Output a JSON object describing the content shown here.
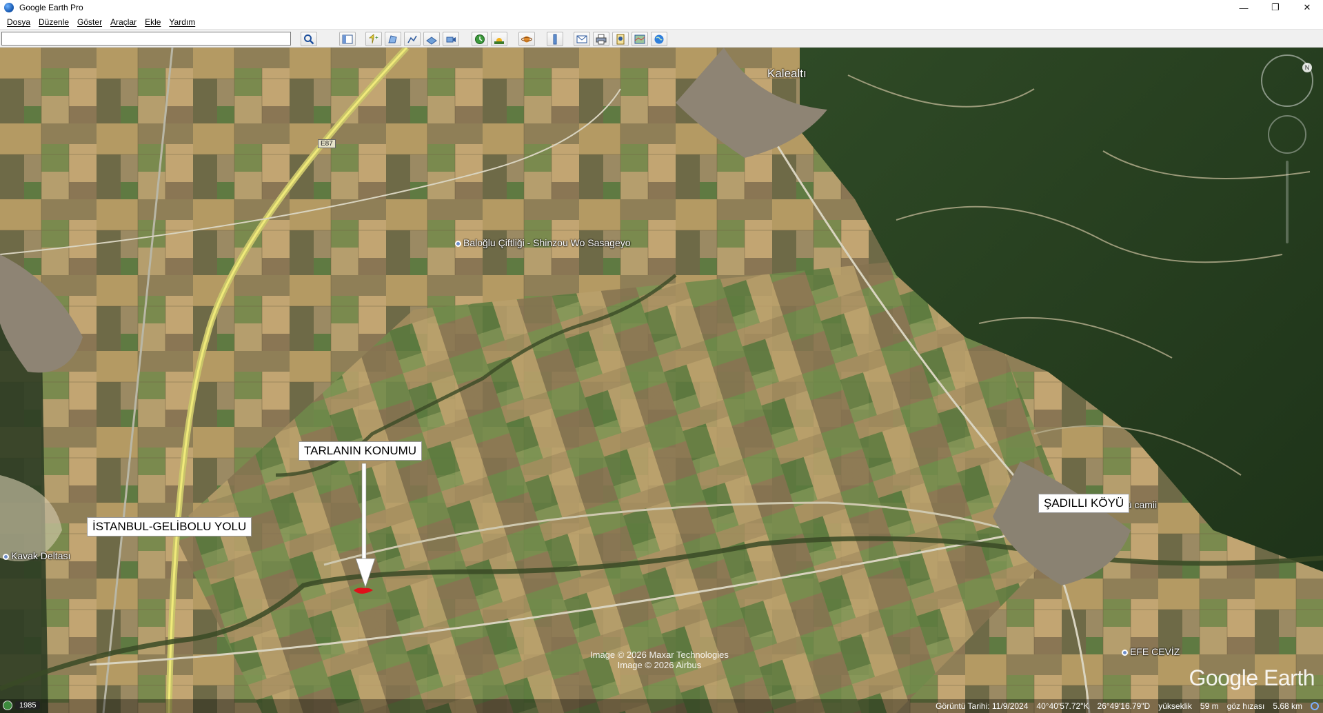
{
  "window": {
    "title": "Google Earth Pro",
    "minimize": "—",
    "maximize": "❐",
    "close": "✕"
  },
  "menu": [
    "Dosya",
    "Düzenle",
    "Göster",
    "Araçlar",
    "Ekle",
    "Yardım"
  ],
  "search": {
    "value": "",
    "placeholder": ""
  },
  "toolbar_icons": [
    "search-icon",
    "sidebar-toggle-icon",
    "add-placemark-icon",
    "add-polygon-icon",
    "add-path-icon",
    "add-image-overlay-icon",
    "record-tour-icon",
    "historical-imagery-icon",
    "sunlight-icon",
    "planets-icon",
    "ruler-icon",
    "email-icon",
    "print-icon",
    "save-image-icon",
    "view-in-maps-icon",
    "earth-gallery-icon"
  ],
  "map": {
    "annotations": {
      "field_location": "TARLANIN KONUMU",
      "road": "İSTANBUL-GELİBOLU YOLU",
      "village": "ŞADILLI KÖYÜ"
    },
    "places": {
      "kalealti": "Kalealtı",
      "e87": "E87",
      "farm": "Baloğlu Çiftliği - Shinzou Wo Sasageyo",
      "kavak": "Kavak Deltası",
      "mosque": "i köyü camii",
      "efe": "EFE CEVİZ"
    },
    "credits": [
      "Image © 2026 Maxar Technologies",
      "Image © 2026 Airbus"
    ],
    "watermark": "Google Earth",
    "historical_year": "1985"
  },
  "status": {
    "imagery_date": "Görüntü Tarihi: 11/9/2024",
    "latitude": "40°40'57.72\"K",
    "longitude": "26°49'16.79\"D",
    "elevation_label": "yükseklik",
    "elevation_value": "59 m",
    "eye_label": "göz hızası",
    "eye_value": "5.68 km"
  },
  "colors": {
    "toolbar_bg": "#f0f0f0",
    "map_base": "#9a8a5a",
    "marker": "#e0101a"
  }
}
